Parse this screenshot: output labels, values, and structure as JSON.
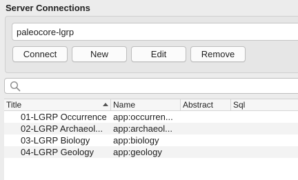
{
  "group": {
    "title": "Server Connections"
  },
  "connection": {
    "selected": "paleocore-lgrp"
  },
  "buttons": {
    "connect": "Connect",
    "new": "New",
    "edit": "Edit",
    "remove": "Remove"
  },
  "search": {
    "value": ""
  },
  "table": {
    "columns": [
      "Title",
      "Name",
      "Abstract",
      "Sql"
    ],
    "sort": {
      "column": "Title",
      "direction": "ascending"
    },
    "rows": [
      {
        "title": "01-LGRP Occurrence",
        "name": "app:occurren..."
      },
      {
        "title": "02-LGRP Archaeol...",
        "name": "app:archaeol..."
      },
      {
        "title": "03-LGRP Biology",
        "name": "app:biology"
      },
      {
        "title": "04-LGRP Geology",
        "name": "app:geology"
      }
    ]
  }
}
